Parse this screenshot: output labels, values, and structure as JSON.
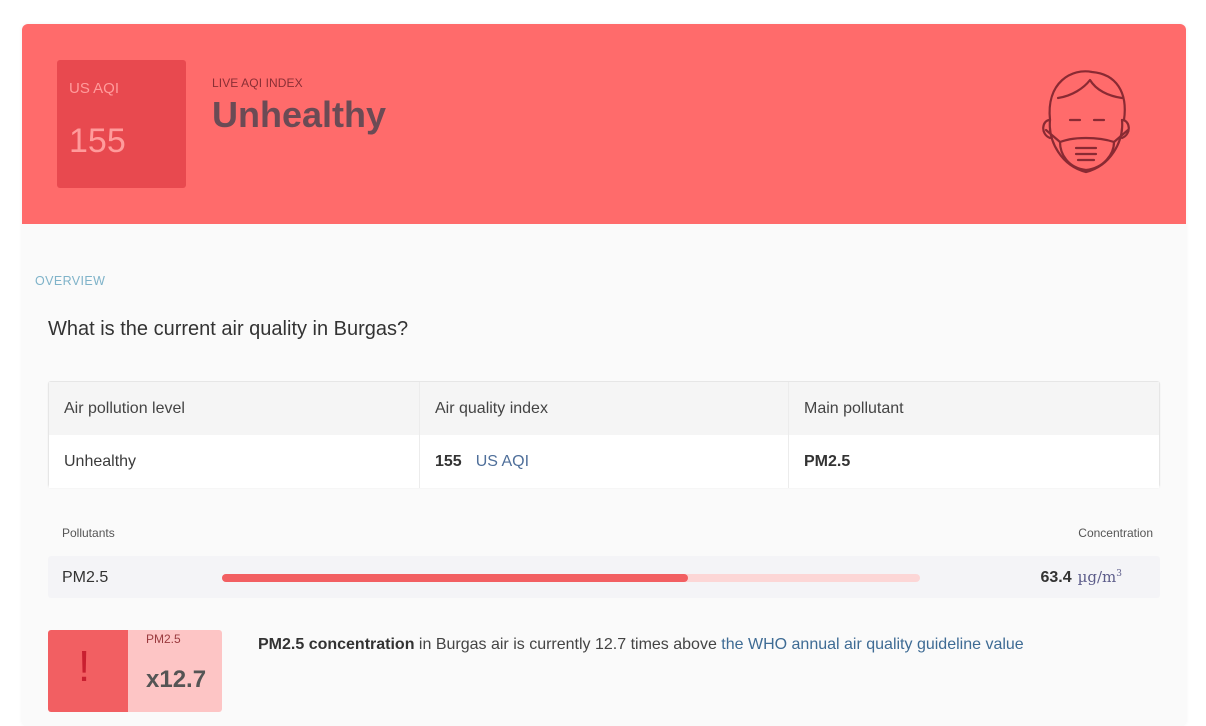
{
  "hero": {
    "aqi_label": "US AQI",
    "aqi_value": "155",
    "kicker": "LIVE AQI INDEX",
    "status": "Unhealthy",
    "icon": "face-mask-icon",
    "color": "#ff6b6b"
  },
  "overview": {
    "section_label": "OVERVIEW",
    "question": "What is the current air quality in Burgas?"
  },
  "table": {
    "headers": [
      "Air pollution level",
      "Air quality index",
      "Main pollutant"
    ],
    "level": "Unhealthy",
    "aqi_value": "155",
    "aqi_unit": "US AQI",
    "main_pollutant": "PM2.5"
  },
  "pollutants": {
    "header_left": "Pollutants",
    "header_right": "Concentration",
    "items": [
      {
        "name": "PM2.5",
        "value": "63.4",
        "unit": "µg/m",
        "unit_sup": "3",
        "level_fraction": 0.667
      }
    ]
  },
  "warning": {
    "icon": "exclamation-icon",
    "pollutant": "PM2.5",
    "multiplier": "x12.7",
    "message_bold": "PM2.5 concentration",
    "message_text": " in Burgas air is currently 12.7 times above ",
    "message_link": "the WHO annual air quality guideline value"
  }
}
